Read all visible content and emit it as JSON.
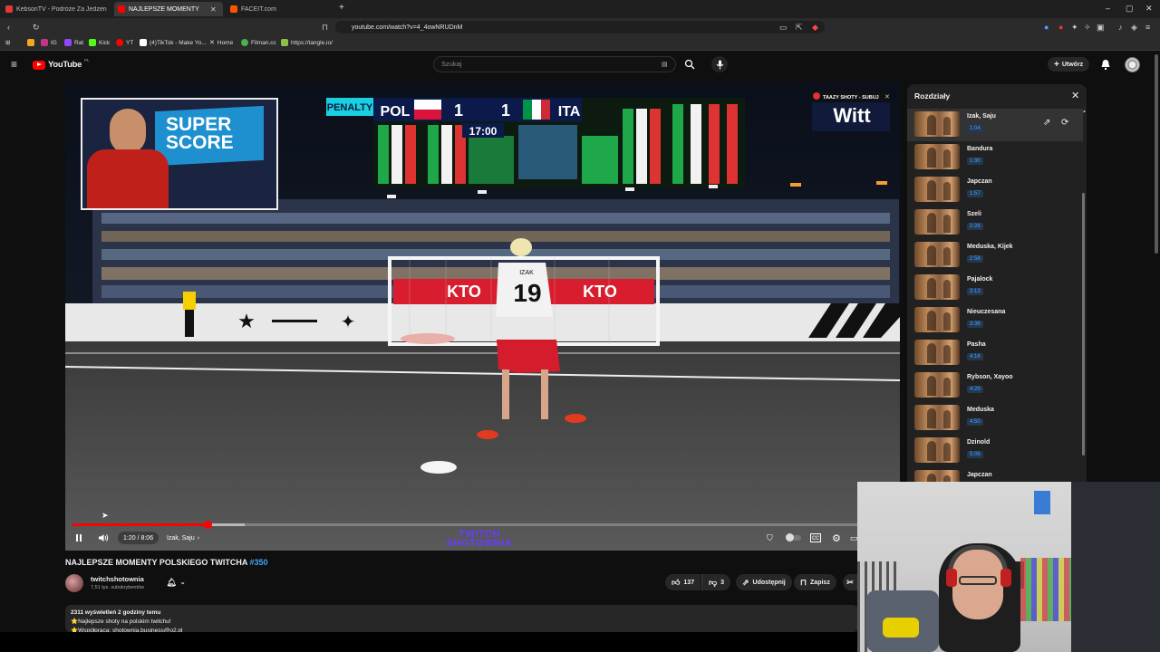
{
  "browser": {
    "tabs": [
      {
        "label": "KebsonTV - Podróże Za Jedzeniem ·",
        "active": false,
        "color": "#e53935"
      },
      {
        "label": "NAJLEPSZE MOMENTY POLS",
        "active": true,
        "color": "#ff0000"
      },
      {
        "label": "FACEIT.com",
        "active": false,
        "color": "#ff5500"
      }
    ],
    "new_tab": "+",
    "window_controls": [
      "–",
      "▢",
      "✕"
    ],
    "url": "youtube.com/watch?v=4_4owNRUDnM",
    "bookmarks": [
      {
        "label": "",
        "color": "#f5a623"
      },
      {
        "label": "IG",
        "color": "#c13584"
      },
      {
        "label": "Rat",
        "color": "#9146ff"
      },
      {
        "label": "Kick",
        "color": "#53fc18"
      },
      {
        "label": "YT",
        "color": "#ff0000"
      },
      {
        "label": "(4)TikTok - Make Yo...",
        "color": "#ffffff"
      },
      {
        "label": "Home",
        "color": "#ffffff"
      },
      {
        "label": "Filman.cc",
        "color": "#4caf50"
      },
      {
        "label": "https://tangle.io/",
        "color": "#8bc34a"
      }
    ]
  },
  "youtube": {
    "logo_text": "YouTube",
    "logo_region": "PL",
    "search_placeholder": "Szukaj",
    "create_label": "Utwórz"
  },
  "player": {
    "progress_fraction": 0.165,
    "buffered_fraction": 0.21,
    "time": "1:20 / 8:06",
    "chapter": "Izak, Saju",
    "watermark_line1": "TWITCH",
    "watermark_line2": "SHOTOWNIA",
    "scoreboard": {
      "label": "PENALTY",
      "home": "POL",
      "home_score": "1",
      "away_score": "1",
      "away": "ITA",
      "clock": "17:00"
    },
    "facecam_text": "SUPER SCORE",
    "sponsor_top": "TAAZY SHOTY - SUBUJ",
    "sponsor_name": "Witt",
    "player_number": "19",
    "player_name": "IZAK",
    "boards": [
      "KTO",
      "KTO"
    ]
  },
  "chapters": {
    "title": "Rozdziały",
    "items": [
      {
        "name": "Izak, Saju",
        "time": "1:04",
        "active": true
      },
      {
        "name": "Bandura",
        "time": "1:30",
        "active": false
      },
      {
        "name": "Japczan",
        "time": "1:57",
        "active": false
      },
      {
        "name": "Szeli",
        "time": "2:26",
        "active": false
      },
      {
        "name": "Meduska, Kijek",
        "time": "2:58",
        "active": false
      },
      {
        "name": "Pajalock",
        "time": "3:13",
        "active": false
      },
      {
        "name": "Nieuczesana",
        "time": "3:36",
        "active": false
      },
      {
        "name": "Pasha",
        "time": "4:16",
        "active": false
      },
      {
        "name": "Rybson, Xayoo",
        "time": "4:29",
        "active": false
      },
      {
        "name": "Meduska",
        "time": "4:50",
        "active": false
      },
      {
        "name": "Dzinold",
        "time": "5:06",
        "active": false
      },
      {
        "name": "Japczan",
        "time": "",
        "active": false
      }
    ]
  },
  "video": {
    "title": "NAJLEPSZE MOMENTY POLSKIEGO TWITCHA",
    "title_tag": "#350",
    "channel_name": "twitchshotownia",
    "subscribers": "7,51 tys. subskrybentów",
    "likes": "137",
    "dislikes": "3",
    "share_label": "Udostępnij",
    "save_label": "Zapisz",
    "views_line": "2311 wyświetleń  2 godziny temu",
    "desc_line1": "⭐Najlepsze shoty na polskim twitchu!",
    "desc_line2": "⭐Współpraca: shotownia.business@o2.pl"
  },
  "colors": {
    "accent_red": "#ff0000",
    "link_blue": "#3ea6ff",
    "watermark_purple": "#6a3cff"
  }
}
